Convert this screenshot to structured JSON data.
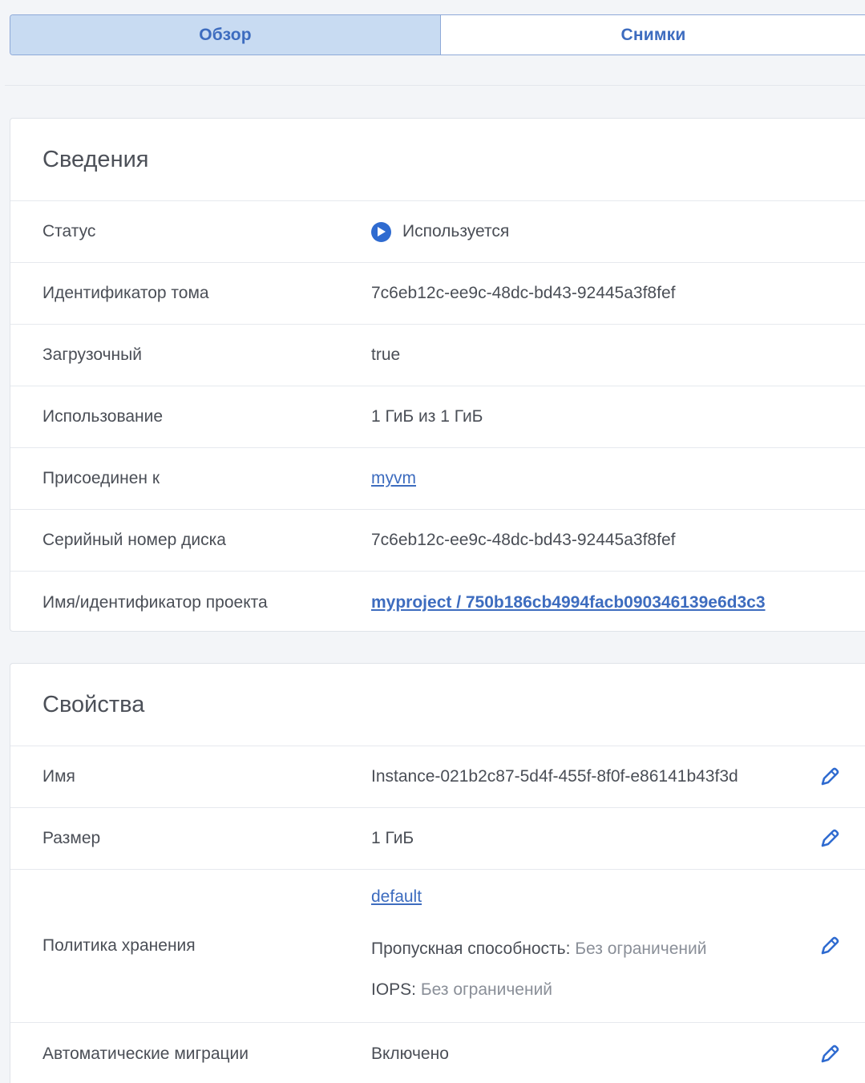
{
  "tabs": [
    {
      "label": "Обзор",
      "active": true
    },
    {
      "label": "Снимки",
      "active": false
    }
  ],
  "info": {
    "title": "Сведения",
    "rows": {
      "status": {
        "label": "Статус",
        "value": "Используется",
        "icon": "play-circle-icon",
        "icon_color": "#2f6bd0"
      },
      "volume_id": {
        "label": "Идентификатор тома",
        "value": "7c6eb12c-ee9c-48dc-bd43-92445a3f8fef"
      },
      "bootable": {
        "label": "Загрузочный",
        "value": "true"
      },
      "usage": {
        "label": "Использование",
        "value": "1 ГиБ из 1 ГиБ"
      },
      "attached_to": {
        "label": "Присоединен к",
        "value": "myvm"
      },
      "serial": {
        "label": "Серийный номер диска",
        "value": "7c6eb12c-ee9c-48dc-bd43-92445a3f8fef"
      },
      "project": {
        "label": "Имя/идентификатор проекта",
        "value": "myproject / 750b186cb4994facb090346139e6d3c3"
      }
    }
  },
  "props": {
    "title": "Свойства",
    "rows": {
      "name": {
        "label": "Имя",
        "value": "Instance-021b2c87-5d4f-455f-8f0f-e86141b43f3d"
      },
      "size": {
        "label": "Размер",
        "value": "1 ГиБ"
      },
      "policy": {
        "label": "Политика хранения",
        "link": "default",
        "throughput_label": "Пропускная способность:",
        "throughput_value": "Без ограничений",
        "iops_label": "IOPS:",
        "iops_value": "Без ограничений"
      },
      "migrations": {
        "label": "Автоматические миграции",
        "value": "Включено"
      }
    }
  },
  "colors": {
    "accent": "#3d6cbf",
    "tab_active_bg": "#c8dbf2",
    "edit_icon": "#2f6bd0"
  }
}
